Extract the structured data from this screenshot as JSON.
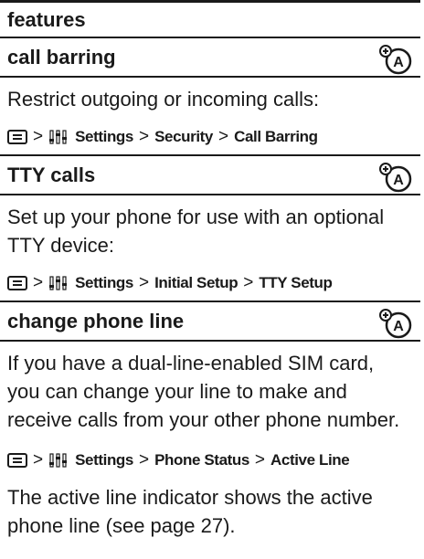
{
  "header": {
    "title": "features"
  },
  "sections": [
    {
      "title": "call barring",
      "description": "Restrict outgoing or incoming calls:",
      "path": {
        "item1": "Settings",
        "item2": "Security",
        "item3": "Call Barring"
      }
    },
    {
      "title": "TTY calls",
      "description": "Set up your phone for use with an optional TTY device:",
      "path": {
        "item1": "Settings",
        "item2": "Initial Setup",
        "item3": "TTY Setup"
      }
    },
    {
      "title": "change phone line",
      "description": "If you have a dual-line-enabled SIM card, you can change your line to make and receive calls from your other phone number.",
      "path": {
        "item1": "Settings",
        "item2": "Phone Status",
        "item3": "Active Line"
      },
      "note": "The active line indicator shows the active phone line (see page 27)."
    }
  ],
  "separator": ">",
  "icons": {
    "menu": "menu-key-icon",
    "settings": "settings-icon",
    "network": "network-feature-icon"
  }
}
